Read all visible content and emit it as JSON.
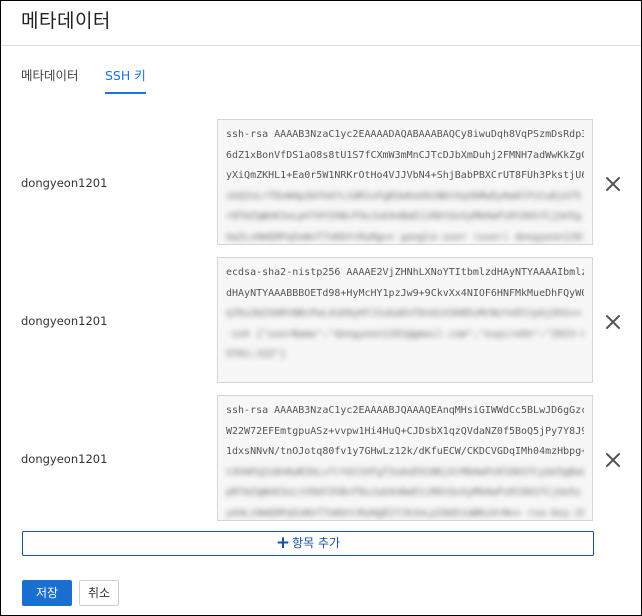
{
  "dialog": {
    "title": "메타데이터"
  },
  "tabs": [
    {
      "label": "메타데이터",
      "active": false
    },
    {
      "label": "SSH 키",
      "active": true
    }
  ],
  "ssh_keys": [
    {
      "user": "dongyeon1201",
      "lines": [
        "ssh-rsa AAAAB3NzaC1yc2EAAAADAQABAAABAQCy8iwuDqh8VqPSzmDsRdp3",
        "6dZ1xBonVfDS1aO8s8tU1S7fCXmW3mMnCJTcDJbXmDuhj2FMNH7adWwKkZgC",
        "yXiQmZKHL1+Ea0r5W1NRKrOtHo4VJJVbN4+ShjBabPBXCrUT8FUh3PkstjU6"
      ],
      "blurred_lines": [
        "xkQ2nLrT8vW4pZmYhA7cJdR1sFgB3eKoU9iN6tXqVbMwEyHa0lPzCuDjGf5",
        "r8TmZqWnK3xLpV7dY2hBcF9sJuG4oNaE1iR6tQvXyMkHwPz0lDbSfCjUe5g",
        "Aa2Lz0mQ9Pq5xWvT7nKbYcRuHg== google-user (user) dongyeon1201@"
      ]
    },
    {
      "user": "dongyeon1201",
      "lines": [
        "ecdsa-sha2-nistp256 AAAAE2VjZHNhLXNoYTItbmlzdHAyNTYAAAAIbmlz",
        "dHAyNTYAAABBBOETd98+HyMcHY1pzJw9+9CkvXx4NIOF6HNFMkMueDhFQyW0"
      ],
      "blurred_lines": [
        "q7KxZm2VbRtN8cPwL4sD9yHfJ1uGaEoT6nQiX3kB5vMrWzYe0lCpAjUhS== google",
        "-ssh {\"userName\":\"dongyeon1201@gmail.com\",\"expireOn\":\"2023-0",
        "5T01:33Z\"}"
      ]
    },
    {
      "user": "dongyeon1201",
      "lines": [
        "ssh-rsa AAAAB3NzaC1yc2EAAAABJQAAAQEAnqMHsiGIWWdCc5BLwJD6gGzc",
        "W22W72EFEmtgpuASz+vvpw1Hi4HuQ+CJDsbX1qzQVdaNZ0f5BoQ5jPy7Y8J9",
        "1dxsNNvN/tnOJotq80fv1y7GHwLz12k/dKfuECW/CKDCVGDqIMh04mzHbpg+"
      ],
      "blurred_lines": [
        "t4VmPqZs8nKwR2bLx7cYdJ1hFgT3uAoE9iN6jXrMkHwPz0lDbSfCyUe5gBaQ",
        "pR7mZqWnK3xLtV9dY2hBcF8sJuG4oNaE1iR6tQvXyMkHwPz0lDbSfCjUe5s",
        "yA4Lz0mQ9Pq5xWvT7nKbYcRuHgE2fJk3oLpI8dS1aW6zXrN== rsa-key-2021"
      ]
    }
  ],
  "add_button": {
    "icon": "plus-icon",
    "label": "항목 추가"
  },
  "footer": {
    "save_label": "저장",
    "cancel_label": "취소"
  },
  "colors": {
    "accent": "#1a6fd0",
    "tab_active": "#1a73e8",
    "outline_button": "#1a4fa0"
  }
}
